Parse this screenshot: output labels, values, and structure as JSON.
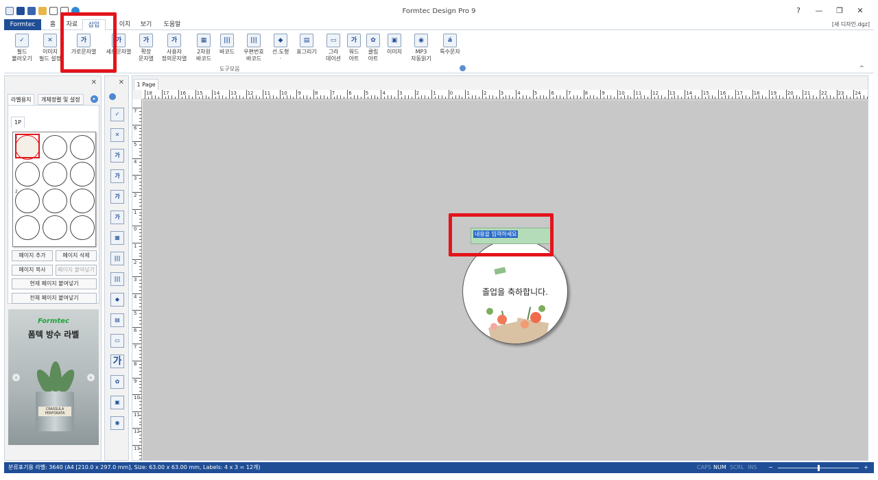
{
  "app": {
    "title": "Formtec Design Pro 9",
    "document": "[새 디자인.dgz]"
  },
  "window_controls": [
    "?",
    "—",
    "❐",
    "✕"
  ],
  "menu": {
    "file_tab": "Formtec",
    "tabs": [
      "홈",
      "자료",
      "삽입",
      "이지",
      "보기",
      "도움말"
    ],
    "active_tab": "삽입"
  },
  "ribbon": {
    "buttons": [
      {
        "label": "필드\n불러오기",
        "icon": "✓"
      },
      {
        "label": "이미지\n필드 설정",
        "icon": "✕"
      },
      {
        "label": "가로문자열",
        "icon": "가"
      },
      {
        "label": "세로문자열",
        "icon": "가"
      },
      {
        "label": "확장\n문자열",
        "icon": "가"
      },
      {
        "label": "사용자\n정의문자열",
        "icon": "가"
      },
      {
        "label": "2차원\n바코드",
        "icon": "▦"
      },
      {
        "label": "바코드",
        "icon": "|||"
      },
      {
        "label": "우편번호\n바코드",
        "icon": "|||"
      },
      {
        "label": "선.도형\n·",
        "icon": "◆"
      },
      {
        "label": "표그리기",
        "icon": "▤"
      },
      {
        "label": "그라\n데이션",
        "icon": "▭"
      },
      {
        "label": "워드\n아트",
        "icon": "가"
      },
      {
        "label": "클립\n아트",
        "icon": "✿"
      },
      {
        "label": "이미지",
        "icon": "▣"
      },
      {
        "label": "MP3\n자동읽기",
        "icon": "◉"
      },
      {
        "label": "특수문자",
        "icon": "á"
      }
    ],
    "group_label": "도구모음",
    "collapse": "^"
  },
  "left_panel": {
    "close": "✕",
    "tabs": [
      "라벨용지",
      "개체정렬 및 설정"
    ],
    "arrow": "▸",
    "page_tab": "1P",
    "mini_numbers": [
      "1",
      "2"
    ],
    "buttons": {
      "add_page": "페이지 추가",
      "delete_page": "페이지 삭제",
      "copy_page": "페이지 복사",
      "paste_page": "페이지 붙여넣기",
      "paste_current": "현재 페이지 붙여넣기",
      "paste_all": "전체 페이지 붙여넣기"
    },
    "ad": {
      "brand": "Formtec",
      "title": "폼텍 방수 라벨",
      "label_line1": "CRASSULA",
      "label_line2": "PERFORATA",
      "prev": "‹",
      "next": "›"
    }
  },
  "tool_strip": {
    "close": "✕",
    "buttons": [
      "✓",
      "✕",
      "가",
      "가",
      "가",
      "가",
      "▦",
      "|||",
      "|||",
      "◆",
      "▤",
      "▭",
      "가",
      "✿",
      "▣",
      "◉"
    ]
  },
  "design": {
    "page_tab": "1 Page",
    "ruler_h": [
      "18",
      "17",
      "16",
      "15",
      "14",
      "13",
      "12",
      "11",
      "10",
      "9",
      "8",
      "7",
      "6",
      "5",
      "4",
      "3",
      "2",
      "1",
      "0",
      "1",
      "2",
      "3",
      "4",
      "5",
      "6",
      "7",
      "8",
      "9",
      "10",
      "11",
      "12",
      "13",
      "14",
      "15",
      "16",
      "17",
      "18",
      "19",
      "20",
      "21",
      "22",
      "23",
      "24"
    ],
    "ruler_v": [
      "7",
      "6",
      "5",
      "4",
      "3",
      "2",
      "1",
      "0",
      "1",
      "2",
      "3",
      "4",
      "5",
      "6",
      "7",
      "8",
      "9",
      "10",
      "11",
      "12",
      "13"
    ],
    "textbox_text": "내용을 입력하세요",
    "label_text": "졸업을 축하합니다."
  },
  "status": {
    "text": "분류표기용 라벨: 3640 (A4 [210.0 x 297.0 mm], Size: 63.00 x 63.00 mm,  Labels: 4 x 3 = 12개)",
    "indicators": [
      {
        "label": "CAPS",
        "on": false
      },
      {
        "label": "NUM",
        "on": true
      },
      {
        "label": "SCRL",
        "on": false
      },
      {
        "label": "INS",
        "on": false
      }
    ],
    "zoom_minus": "−",
    "zoom_plus": "+",
    "zoom_level": 0.5
  },
  "colors": {
    "accent": "#1f4e96",
    "highlight": "#e3141b",
    "canvas": "#c8c8c8",
    "textbox_fill": "#b5dcb8",
    "selection": "#2a6cc9"
  }
}
